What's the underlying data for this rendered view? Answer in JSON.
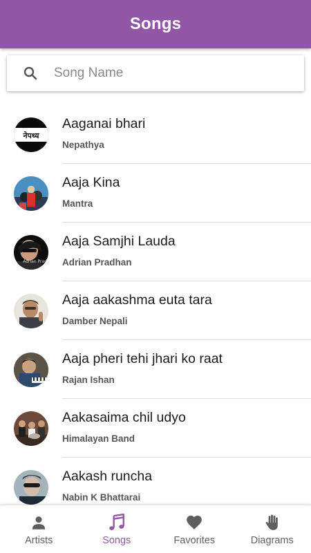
{
  "appbar": {
    "title": "Songs"
  },
  "search": {
    "placeholder": "Song Name",
    "value": ""
  },
  "avatar_text": {
    "nepathya": "नेपथ्य",
    "adrian": "Adrian Prad"
  },
  "songs": [
    {
      "title": "Aaganai bhari",
      "artist": "Nepathya"
    },
    {
      "title": "Aaja Kina",
      "artist": "Mantra"
    },
    {
      "title": "Aaja Samjhi Lauda",
      "artist": "Adrian Pradhan"
    },
    {
      "title": "Aaja aakashma euta tara",
      "artist": "Damber Nepali"
    },
    {
      "title": "Aaja pheri tehi jhari ko raat",
      "artist": "Rajan Ishan"
    },
    {
      "title": "Aakasaima chil udyo",
      "artist": "Himalayan Band"
    },
    {
      "title": "Aakash runcha",
      "artist": "Nabin K Bhattarai"
    }
  ],
  "nav": {
    "items": [
      {
        "label": "Artists",
        "icon": "person-icon",
        "active": false
      },
      {
        "label": "Songs",
        "icon": "music-note-icon",
        "active": true
      },
      {
        "label": "Favorites",
        "icon": "heart-icon",
        "active": false
      },
      {
        "label": "Diagrams",
        "icon": "hand-icon",
        "active": false
      }
    ]
  },
  "colors": {
    "primary": "#9157a6",
    "nav_inactive": "#5f5f5f",
    "divider": "#dcdcdc"
  }
}
